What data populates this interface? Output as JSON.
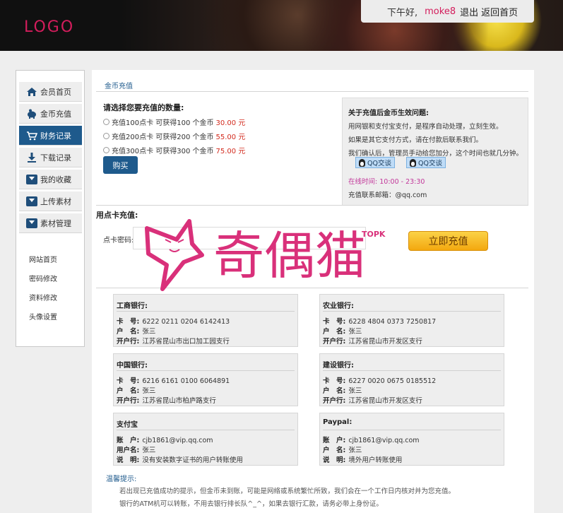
{
  "header": {
    "logo": "LOGO",
    "greeting": "下午好,",
    "username": "moke8",
    "logout": "退出",
    "home": "返回首页"
  },
  "sidebar": {
    "items": [
      {
        "label": "会员首页",
        "icon": "home-icon"
      },
      {
        "label": "金币充值",
        "icon": "piggy-bank-icon"
      },
      {
        "label": "财务记录",
        "icon": "cart-icon",
        "active": true
      },
      {
        "label": "下载记录",
        "icon": "download-icon"
      },
      {
        "label": "我的收藏",
        "icon": "inbox-icon"
      },
      {
        "label": "上传素材",
        "icon": "inbox-icon"
      },
      {
        "label": "素材管理",
        "icon": "inbox-icon"
      }
    ],
    "links": [
      "网站首页",
      "密码修改",
      "资料修改",
      "头像设置"
    ]
  },
  "main": {
    "tab": "金币充值",
    "amount_title": "请选择您要充值的数量:",
    "options": [
      {
        "text": "充值100点卡 可获得100 个金币",
        "price": "30.00 元"
      },
      {
        "text": "充值200点卡 可获得200 个金币",
        "price": "55.00 元"
      },
      {
        "text": "充值300点卡 可获得300 个金币",
        "price": "75.00 元"
      }
    ],
    "buy": "购买",
    "info": {
      "title": "关于充值后金币生效问题:",
      "line1": "用网银和支付宝支付，是程序自动处理，立刻生效。",
      "line2": "如果是其它支付方式，请在付款后联系我们。",
      "line3": "我们确认后，管理员手动给您加分，这个时间也就几分钟。",
      "qq1": "QQ交谈",
      "qq2": "QQ交谈",
      "online_label": "在线时间:",
      "online_time": "10:00 - 23:30",
      "email": "充值联系邮箱：@qq.com"
    },
    "card": {
      "title": "用点卡充值:",
      "label": "点卡密码:",
      "submit": "立即充值"
    },
    "banks": [
      {
        "name": "工商银行:",
        "rows": [
          [
            "卡　号:",
            "6222 0211 0204 6142413"
          ],
          [
            "户　名:",
            "张三"
          ],
          [
            "开户行:",
            "江苏省昆山市出口加工园支行"
          ]
        ]
      },
      {
        "name": "农业银行:",
        "rows": [
          [
            "卡　号:",
            "6228 4804 0373 7250817"
          ],
          [
            "户　名:",
            "张三"
          ],
          [
            "开户行:",
            "江苏省昆山市开发区支行"
          ]
        ]
      },
      {
        "name": "中国银行:",
        "rows": [
          [
            "卡　号:",
            "6216 6161 0100 6064891"
          ],
          [
            "户　名:",
            "张三"
          ],
          [
            "开户行:",
            "江苏省昆山市柏庐路支行"
          ]
        ]
      },
      {
        "name": "建设银行:",
        "rows": [
          [
            "卡　号:",
            "6227 0020 0675 0185512"
          ],
          [
            "户　名:",
            "张三"
          ],
          [
            "开户行:",
            "江苏省昆山市开发区支行"
          ]
        ]
      },
      {
        "name": "支付宝",
        "rows": [
          [
            "账　户:",
            "cjb1861@vip.qq.com"
          ],
          [
            "用户名:",
            "张三"
          ],
          [
            "说　明:",
            "没有安装数字证书的用户转账使用"
          ]
        ]
      },
      {
        "name": "Paypal:",
        "rows": [
          [
            "账　户:",
            "cjb1861@vip.qq.com"
          ],
          [
            "户　名:",
            "张三"
          ],
          [
            "说　明:",
            "境外用户转账使用"
          ]
        ]
      }
    ],
    "tips_title": "温馨提示:",
    "tips": [
      "若出现已充值成功的提示，但金币未到账，可能是网络或系统繁忙所致，我们会在一个工作日内核对并为您充值。",
      "银行的ATM机可以转账，不用去银行排长队^_^，如果去银行汇款，请务必带上身份证。"
    ]
  },
  "watermark": {
    "text": "奇偶猫",
    "sub": "TOPK"
  }
}
